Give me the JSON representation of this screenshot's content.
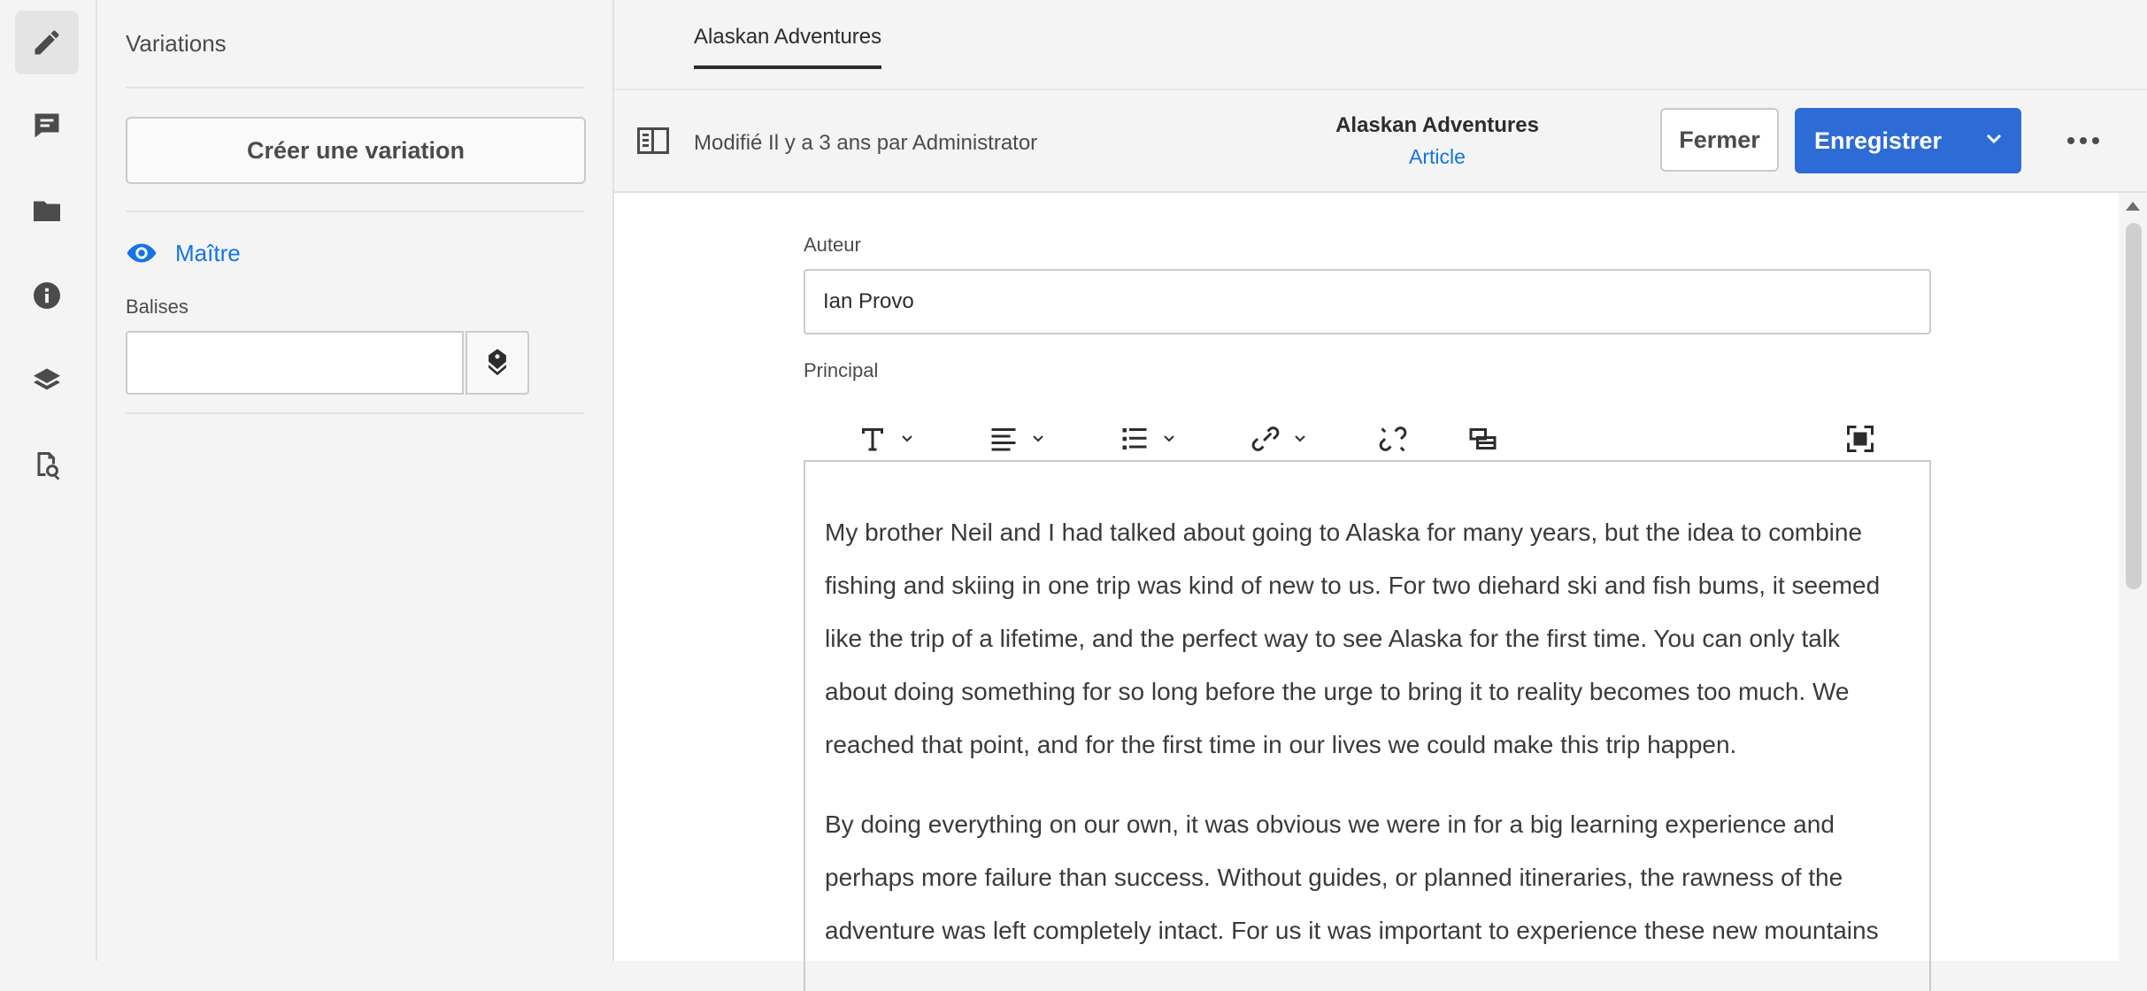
{
  "rail": {
    "items": [
      {
        "icon": "pencil-icon",
        "active": true
      },
      {
        "icon": "comment-icon",
        "active": false
      },
      {
        "icon": "folder-icon",
        "active": false
      },
      {
        "icon": "info-icon",
        "active": false
      },
      {
        "icon": "layers-icon",
        "active": false
      },
      {
        "icon": "asset-search-icon",
        "active": false
      }
    ]
  },
  "panel": {
    "title": "Variations",
    "create_button": "Créer une variation",
    "master_label": "Maître",
    "tags_label": "Balises",
    "tags_value": ""
  },
  "tabs": [
    {
      "label": "Alaskan Adventures",
      "active": true
    }
  ],
  "header": {
    "modified": "Modifié Il y a 3 ans par Administrator",
    "fragment_title": "Alaskan Adventures",
    "fragment_model": "Article",
    "close_label": "Fermer",
    "save_label": "Enregistrer"
  },
  "form": {
    "author_label": "Auteur",
    "author_value": "Ian Provo",
    "main_label": "Principal",
    "toolbar": [
      "text-format-icon",
      "align-icon",
      "list-icon",
      "link-icon",
      "unlink-icon",
      "insert-asset-icon",
      "fullscreen-icon"
    ],
    "paragraphs": [
      {
        "lines": [
          "My brother Neil and I had talked about going to Alaska for many years, but the idea to combine",
          "fishing and skiing in one trip was kind of new to us. For two diehard ski and fish bums, it seemed",
          "like the trip of a lifetime, and the perfect way to see Alaska for the first time. You can only talk",
          "about doing something for so long before the urge to bring it to reality becomes too much. We",
          "reached that point, and for the first time in our lives we could make this trip happen."
        ]
      },
      {
        "lines": [
          "By doing everything on our own, it was obvious we were in for a big learning experience and",
          "perhaps more failure than success. Without guides, or planned itineraries, the rawness of the",
          "adventure was left completely intact. For us it was important to experience these new mountains"
        ]
      }
    ]
  },
  "colors": {
    "accent": "#2d6cd6",
    "link": "#1473e6"
  }
}
